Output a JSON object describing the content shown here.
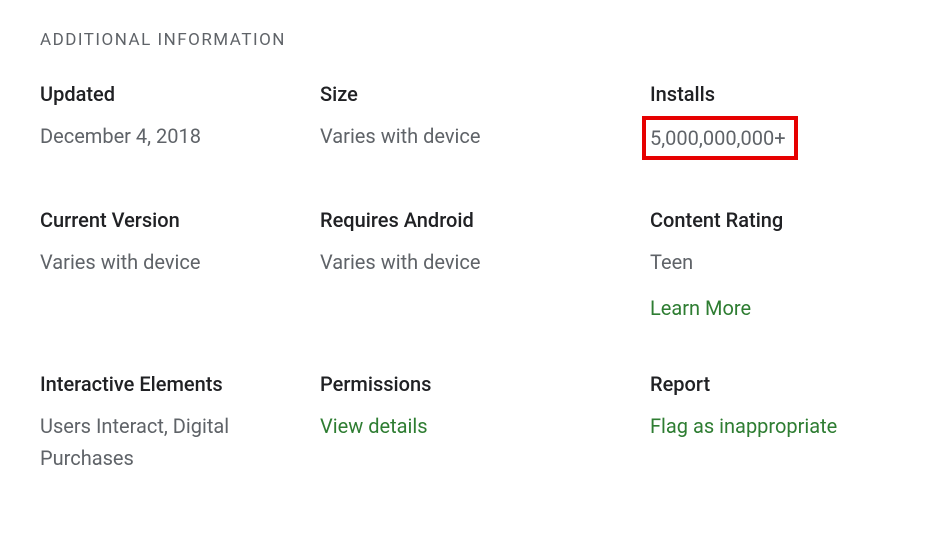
{
  "section_title": "ADDITIONAL INFORMATION",
  "items": [
    {
      "label": "Updated",
      "value": "December 4, 2018"
    },
    {
      "label": "Size",
      "value": "Varies with device"
    },
    {
      "label": "Installs",
      "value": "5,000,000,000+",
      "highlighted": true
    },
    {
      "label": "Current Version",
      "value": "Varies with device"
    },
    {
      "label": "Requires Android",
      "value": "Varies with device"
    },
    {
      "label": "Content Rating",
      "value": "Teen",
      "link": "Learn More"
    },
    {
      "label": "Interactive Elements",
      "value": "Users Interact, Digital Purchases"
    },
    {
      "label": "Permissions",
      "link_only": "View details"
    },
    {
      "label": "Report",
      "link_only": "Flag as inappropriate"
    }
  ]
}
